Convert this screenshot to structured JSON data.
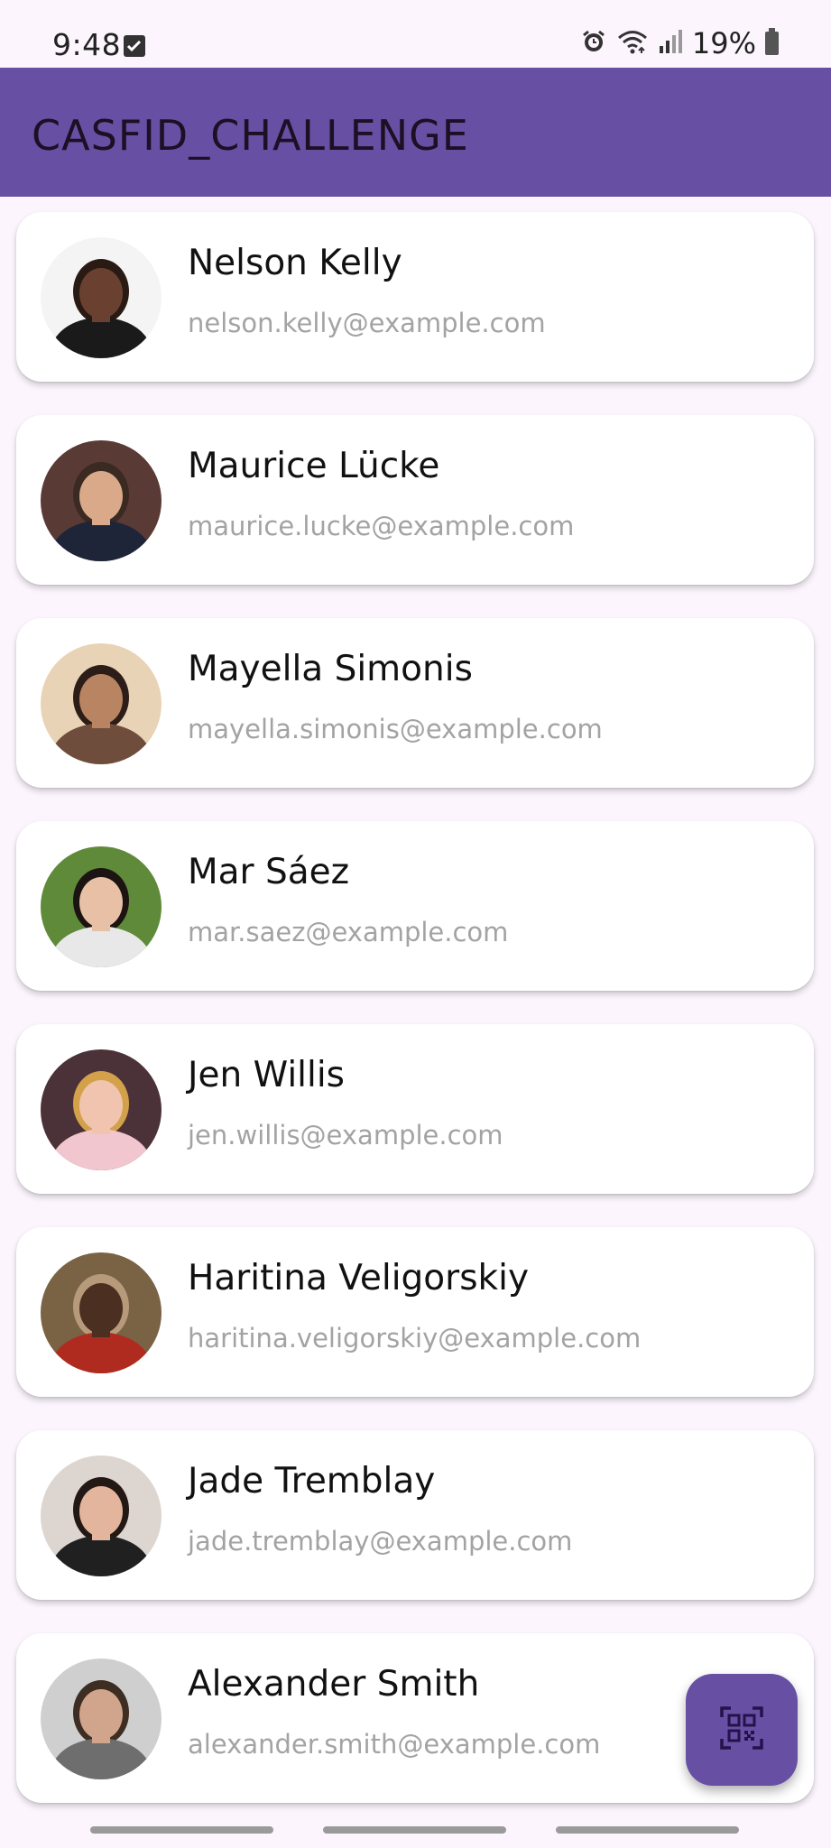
{
  "status_bar": {
    "time": "9:48",
    "battery": "19%",
    "icons": [
      "check-icon",
      "alarm-icon",
      "wifi-icon",
      "signal-icon",
      "battery-icon"
    ]
  },
  "app_bar": {
    "title": "CASFID_CHALLENGE"
  },
  "contacts": [
    {
      "name": "Nelson Kelly",
      "email": "nelson.kelly@example.com",
      "avatar_bg": "#f4f4f4",
      "skin": "#6a4130",
      "shirt": "#1a1a1a",
      "hair": "#2a1a14"
    },
    {
      "name": "Maurice Lücke",
      "email": "maurice.lucke@example.com",
      "avatar_bg": "#5a3a35",
      "skin": "#d9a98a",
      "shirt": "#1e2538",
      "hair": "#3a2a22"
    },
    {
      "name": "Mayella Simonis",
      "email": "mayella.simonis@example.com",
      "avatar_bg": "#e9d3b6",
      "skin": "#b88462",
      "shirt": "#6f4d3d",
      "hair": "#2d1d18"
    },
    {
      "name": "Mar Sáez",
      "email": "mar.saez@example.com",
      "avatar_bg": "#5f8a3a",
      "skin": "#e8c0a6",
      "shirt": "#e8e8e8",
      "hair": "#1b1412"
    },
    {
      "name": "Jen Willis",
      "email": "jen.willis@example.com",
      "avatar_bg": "#4a3238",
      "skin": "#f0c4ae",
      "shirt": "#f1c6cf",
      "hair": "#d3a14a"
    },
    {
      "name": "Haritina Veligorskiy",
      "email": "haritina.veligorskiy@example.com",
      "avatar_bg": "#7a6245",
      "skin": "#4b2f21",
      "shirt": "#b02b1f",
      "hair": "#b79a7a"
    },
    {
      "name": "Jade Tremblay",
      "email": "jade.tremblay@example.com",
      "avatar_bg": "#ddd5cf",
      "skin": "#e2b59c",
      "shirt": "#202020",
      "hair": "#241815"
    },
    {
      "name": "Alexander Smith",
      "email": "alexander.smith@example.com",
      "avatar_bg": "#cfcfcf",
      "skin": "#d1a58b",
      "shirt": "#6e6e6e",
      "hair": "#3e2d22"
    }
  ],
  "fab": {
    "icon": "qr-code-scanner-icon"
  },
  "colors": {
    "primary": "#6750a4",
    "background": "#fcf5fd",
    "card": "#ffffff",
    "email_text": "#a3a3a3"
  }
}
